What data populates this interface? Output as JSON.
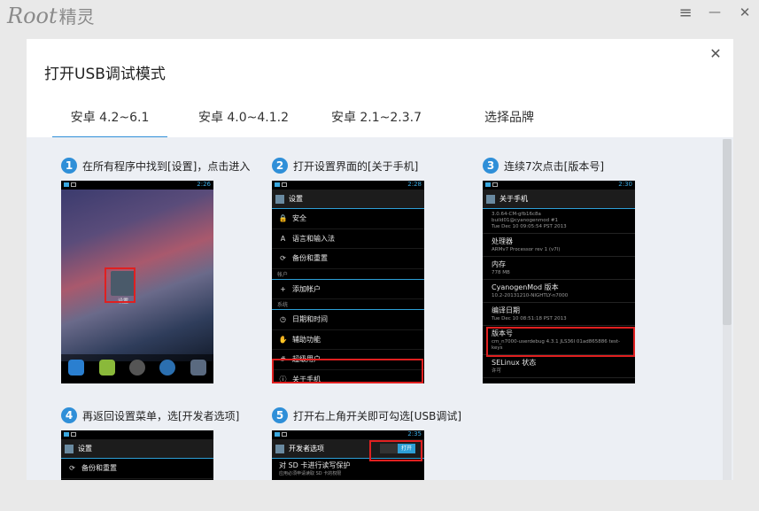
{
  "app": {
    "logo_en": "Root",
    "logo_cn": "精灵"
  },
  "window_controls": {
    "menu": "≡",
    "minimize": "—",
    "close": "✕"
  },
  "dialog": {
    "title": "打开USB调试模式",
    "close": "✕",
    "tabs": [
      {
        "label": "安卓 4.2~6.1",
        "active": true
      },
      {
        "label": "安卓 4.0~4.1.2",
        "active": false
      },
      {
        "label": "安卓 2.1~2.3.7",
        "active": false
      },
      {
        "label": "选择品牌",
        "active": false
      }
    ]
  },
  "steps": [
    {
      "num": "1",
      "text": "在所有程序中找到[设置]，点击进入"
    },
    {
      "num": "2",
      "text": "打开设置界面的[关于手机]"
    },
    {
      "num": "3",
      "text": "连续7次点击[版本号]"
    },
    {
      "num": "4",
      "text": "再返回设置菜单，选[开发者选项]"
    },
    {
      "num": "5",
      "text": "打开右上角开关即可勾选[USB调试]"
    }
  ],
  "phone1": {
    "time": "2:26",
    "settings_label": "设置"
  },
  "phone2": {
    "time": "2:28",
    "title": "设置",
    "rows": [
      {
        "icon": "lock-icon",
        "glyph": "🔒",
        "label": "安全"
      },
      {
        "icon": "language-icon",
        "glyph": "A",
        "label": "语言和输入法"
      },
      {
        "icon": "backup-icon",
        "glyph": "⟳",
        "label": "备份和重置"
      }
    ],
    "header_account": "帐户",
    "row_add_account": {
      "glyph": "+",
      "label": "添加帐户"
    },
    "header_system": "系统",
    "rows2": [
      {
        "icon": "clock-icon",
        "glyph": "◷",
        "label": "日期和时间"
      },
      {
        "icon": "hand-icon",
        "glyph": "✋",
        "label": "辅助功能"
      },
      {
        "icon": "hash-icon",
        "glyph": "#",
        "label": "超级用户"
      },
      {
        "icon": "info-icon",
        "glyph": "ⓘ",
        "label": "关于手机"
      }
    ]
  },
  "phone3": {
    "time": "2:30",
    "title": "关于手机",
    "top_lines": "3.0.64-CM-gfb16c8a\nbuild01@cyanogenmod #1\nTue Dec 10 09:05:54 PST 2013",
    "items": [
      {
        "key": "处理器",
        "value": "ARMv7 Processor rev 1 (v7l)"
      },
      {
        "key": "内存",
        "value": "778 MB"
      },
      {
        "key": "CyanogenMod 版本",
        "value": "10.2-20131210-NIGHTLY-n7000"
      },
      {
        "key": "编译日期",
        "value": "Tue Dec 10 08:51:18 PST 2013"
      },
      {
        "key": "版本号",
        "value": "cm_n7000-userdebug 4.3.1 JLS36I 01ad865886 test-keys"
      },
      {
        "key": "SELinux 状态",
        "value": "许可"
      }
    ]
  },
  "phone4": {
    "time": "",
    "title": "设置",
    "row": "备份和重置"
  },
  "phone5": {
    "time": "2:35",
    "title": "开发者选项",
    "switch_label": "打开",
    "row": "对 SD 卡进行读写保护",
    "row_sub": "应用必须申请读取 SD 卡的权限"
  }
}
